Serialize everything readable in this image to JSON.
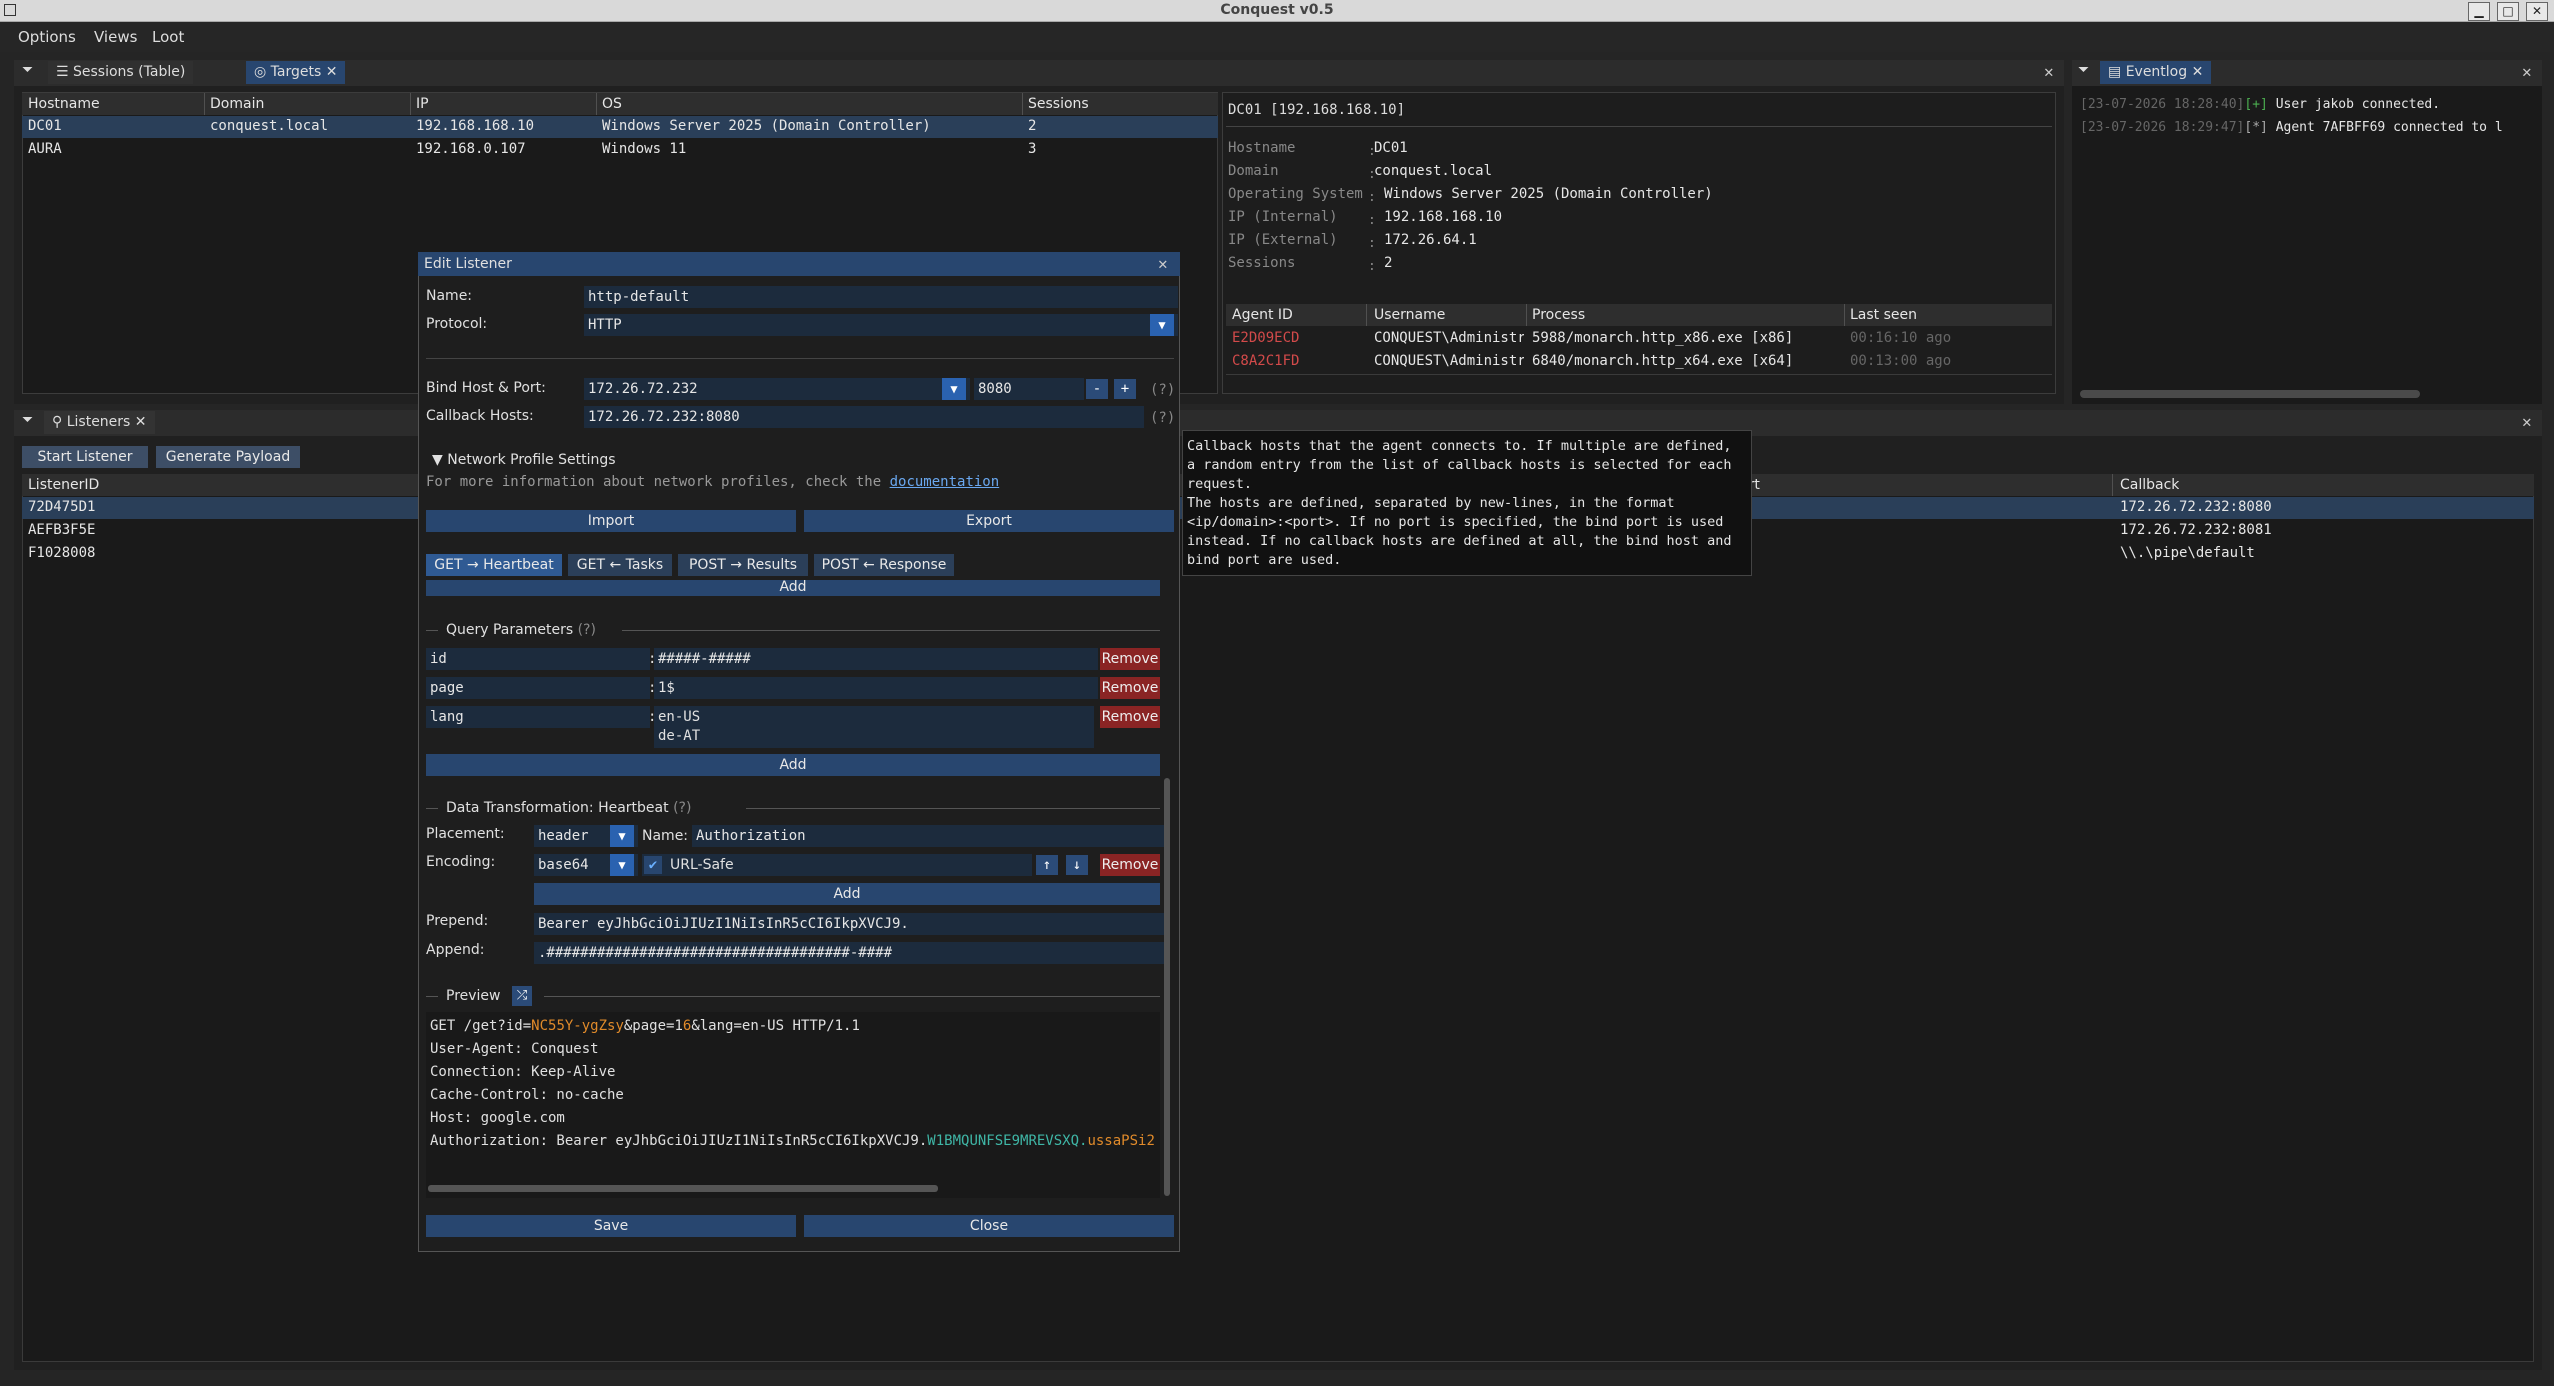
{
  "window": {
    "title": "Conquest v0.5"
  },
  "menu": [
    "Options",
    "Views",
    "Loot"
  ],
  "targets_panel": {
    "tabs": [
      "Sessions (Table)",
      "Targets"
    ],
    "columns": [
      "Hostname",
      "Domain",
      "IP",
      "OS",
      "Sessions"
    ],
    "rows": [
      [
        "DC01",
        "conquest.local",
        "192.168.168.10",
        "Windows Server 2025 (Domain Controller)",
        "2"
      ],
      [
        "AURA",
        "",
        "192.168.0.107",
        "Windows 11",
        "3"
      ]
    ]
  },
  "details": {
    "header": "DC01 [192.168.168.10]",
    "fields": [
      {
        "key": "Hostname",
        "value": "DC01"
      },
      {
        "key": "Domain",
        "value": "conquest.local"
      },
      {
        "key": "Operating System",
        "value": "Windows Server 2025 (Domain Controller)"
      },
      {
        "key": "IP (Internal)",
        "value": "192.168.168.10"
      },
      {
        "key": "IP (External)",
        "value": "172.26.64.1"
      },
      {
        "key": "Sessions",
        "value": "2"
      }
    ],
    "agent_columns": [
      "Agent ID",
      "Username",
      "Process",
      "Last seen"
    ],
    "agents": [
      [
        "E2D09ECD",
        "CONQUEST\\Administrator",
        "5988/monarch.http_x86.exe [x86]",
        "00:16:10 ago"
      ],
      [
        "C8A2C1FD",
        "CONQUEST\\Administrator",
        "6840/monarch.http_x64.exe [x64]",
        "00:13:00 ago"
      ]
    ]
  },
  "eventlog": {
    "tab": "Eventlog",
    "entries": [
      {
        "ts": "[23-07-2026 18:28:40]",
        "tag": "[+]",
        "text": "User jakob connected."
      },
      {
        "ts": "[23-07-2026 18:29:47]",
        "tag": "[*]",
        "text": "Agent 7AFBFF69 connected to l"
      }
    ]
  },
  "listeners_panel": {
    "tab": "Listeners",
    "buttons": [
      "Start Listener",
      "Generate Payload"
    ],
    "columns": [
      "ListenerID",
      "ort",
      "Callback"
    ],
    "rows": [
      [
        "72D475D1",
        "172.26.72.232:8080"
      ],
      [
        "AEFB3F5E",
        "172.26.72.232:8081"
      ],
      [
        "F1028008",
        "\\\\.\\pipe\\default"
      ]
    ]
  },
  "dialog": {
    "title": "Edit Listener",
    "name_label": "Name:",
    "name_value": "http-default",
    "protocol_label": "Protocol:",
    "protocol_value": "HTTP",
    "bind_label": "Bind Host & Port:",
    "bind_host": "172.26.72.232",
    "bind_port": "8080",
    "minus": "-",
    "plus": "+",
    "help": "(?)",
    "callback_label": "Callback Hosts:",
    "callback_value": "172.26.72.232:8080",
    "network_profile": "Network Profile Settings",
    "profile_info": "For more information about network profiles, check the",
    "profile_link": "documentation",
    "import": "Import",
    "export": "Export",
    "subtabs": [
      "GET → Heartbeat",
      "GET ← Tasks",
      "POST → Results",
      "POST ← Response"
    ],
    "add": "Add",
    "query_section": "Query Parameters",
    "query_params": [
      {
        "key": "id",
        "value": "#####-#####"
      },
      {
        "key": "page",
        "value": "1$"
      },
      {
        "key": "lang",
        "value": "en-US",
        "value2": "de-AT"
      }
    ],
    "remove": "Remove",
    "transform_section": "Data Transformation: Heartbeat",
    "placement_label": "Placement:",
    "placement_value": "header",
    "name2_label": "Name:",
    "name2_value": "Authorization",
    "encoding_label": "Encoding:",
    "encoding_value": "base64",
    "urlsafe": "URL-Safe",
    "prepend_label": "Prepend:",
    "prepend_value": "Bearer eyJhbGciOiJIUzI1NiIsInR5cCI6IkpXVCJ9.",
    "append_label": "Append:",
    "append_value": ".####################################-####",
    "preview_section": "Preview",
    "preview": {
      "line1_a": "GET /get?id=",
      "line1_b": "NC55Y-ygZsy",
      "line1_c": "&page=1",
      "line1_d": "6",
      "line1_e": "&lang=en-US HTTP/1.1",
      "line2": "User-Agent: Conquest",
      "line3": "Connection: Keep-Alive",
      "line4": "Cache-Control: no-cache",
      "line5": "Host: google.com",
      "line6_a": "Authorization: Bearer eyJhbGciOiJIUzI1NiIsInR5cCI6IkpXVCJ9.",
      "line6_b": "W1BMQUNFSE9MREVSXQ.",
      "line6_c": "ussaPSi2"
    },
    "save": "Save",
    "close": "Close"
  },
  "tooltip": {
    "lines": [
      "Callback hosts that the agent connects to. If multiple are defined,",
      "a random entry from the list of callback hosts is selected for each",
      "request.",
      "The hosts are defined, separated by new-lines, in the format",
      "<ip/domain>:<port>. If no port is specified, the bind port is used",
      "instead. If no callback hosts are defined at all, the bind host and",
      "bind port are used."
    ]
  }
}
